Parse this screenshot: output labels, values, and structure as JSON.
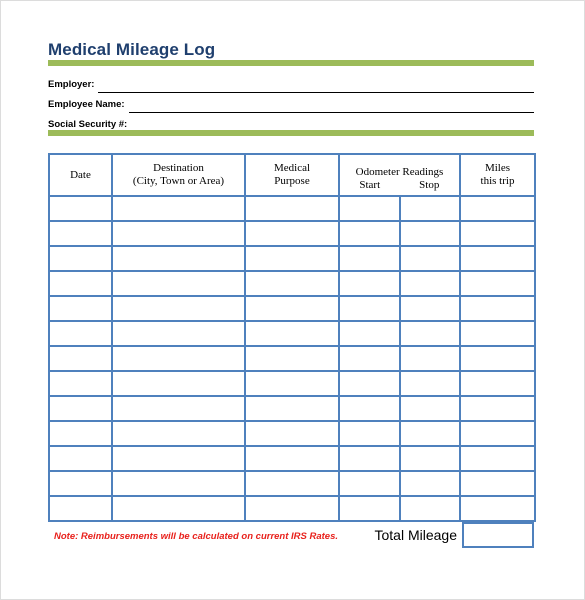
{
  "document": {
    "title": "Medical Mileage Log"
  },
  "accent_colors": {
    "title_blue": "#1F3F6E",
    "rule_green": "#9CBB59",
    "table_blue": "#4F81BD",
    "note_red": "#E8211C"
  },
  "fields": [
    {
      "label": "Employer:",
      "value": ""
    },
    {
      "label": "Employee Name:",
      "value": ""
    },
    {
      "label": "Social Security #:",
      "value": ""
    }
  ],
  "table": {
    "headers": {
      "date": "Date",
      "destination_line1": "Destination",
      "destination_line2": "(City, Town or Area)",
      "purpose_line1": "Medical",
      "purpose_line2": "Purpose",
      "odometer_title": "Odometer Readings",
      "odometer_start": "Start",
      "odometer_stop": "Stop",
      "miles_line1": "Miles",
      "miles_line2": "this trip"
    },
    "row_count": 13,
    "rows": [
      {
        "date": "",
        "destination": "",
        "purpose": "",
        "start": "",
        "stop": "",
        "miles": ""
      },
      {
        "date": "",
        "destination": "",
        "purpose": "",
        "start": "",
        "stop": "",
        "miles": ""
      },
      {
        "date": "",
        "destination": "",
        "purpose": "",
        "start": "",
        "stop": "",
        "miles": ""
      },
      {
        "date": "",
        "destination": "",
        "purpose": "",
        "start": "",
        "stop": "",
        "miles": ""
      },
      {
        "date": "",
        "destination": "",
        "purpose": "",
        "start": "",
        "stop": "",
        "miles": ""
      },
      {
        "date": "",
        "destination": "",
        "purpose": "",
        "start": "",
        "stop": "",
        "miles": ""
      },
      {
        "date": "",
        "destination": "",
        "purpose": "",
        "start": "",
        "stop": "",
        "miles": ""
      },
      {
        "date": "",
        "destination": "",
        "purpose": "",
        "start": "",
        "stop": "",
        "miles": ""
      },
      {
        "date": "",
        "destination": "",
        "purpose": "",
        "start": "",
        "stop": "",
        "miles": ""
      },
      {
        "date": "",
        "destination": "",
        "purpose": "",
        "start": "",
        "stop": "",
        "miles": ""
      },
      {
        "date": "",
        "destination": "",
        "purpose": "",
        "start": "",
        "stop": "",
        "miles": ""
      },
      {
        "date": "",
        "destination": "",
        "purpose": "",
        "start": "",
        "stop": "",
        "miles": ""
      },
      {
        "date": "",
        "destination": "",
        "purpose": "",
        "start": "",
        "stop": "",
        "miles": ""
      }
    ]
  },
  "footer": {
    "note": "Note: Reimbursements will be calculated on current IRS Rates.",
    "total_label": "Total Mileage",
    "total_value": ""
  }
}
